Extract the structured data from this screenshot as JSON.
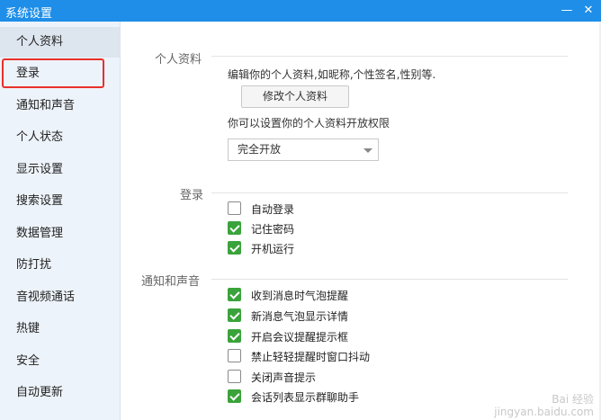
{
  "window": {
    "title": "系统设置",
    "minimize_icon": "minimize-icon",
    "close_icon": "close-icon"
  },
  "sidebar": {
    "items": [
      {
        "label": "个人资料",
        "active": true
      },
      {
        "label": "登录",
        "highlighted": true
      },
      {
        "label": "通知和声音"
      },
      {
        "label": "个人状态"
      },
      {
        "label": "显示设置"
      },
      {
        "label": "搜索设置"
      },
      {
        "label": "数据管理"
      },
      {
        "label": "防打扰"
      },
      {
        "label": "音视频通话"
      },
      {
        "label": "热键"
      },
      {
        "label": "安全"
      },
      {
        "label": "自动更新"
      }
    ],
    "highlight_color": "#e8302b"
  },
  "profile": {
    "section_title": "个人资料",
    "description": "编辑你的个人资料,如昵称,个性签名,性别等.",
    "edit_button": "修改个人资料",
    "permission_text": "你可以设置你的个人资料开放权限",
    "permission_select_value": "完全开放"
  },
  "login": {
    "section_title": "登录",
    "options": [
      {
        "label": "自动登录",
        "checked": false
      },
      {
        "label": "记住密码",
        "checked": true
      },
      {
        "label": "开机运行",
        "checked": true
      }
    ]
  },
  "notify": {
    "section_title": "通知和声音",
    "options": [
      {
        "label": "收到消息时气泡提醒",
        "checked": true
      },
      {
        "label": "新消息气泡显示详情",
        "checked": true
      },
      {
        "label": "开启会议提醒提示框",
        "checked": true
      },
      {
        "label": "禁止轻轻提醒时窗口抖动",
        "checked": false
      },
      {
        "label": "关闭声音提示",
        "checked": false
      },
      {
        "label": "会话列表显示群聊助手",
        "checked": true
      }
    ]
  },
  "watermark": {
    "line1": "Bai 经验",
    "line2": "jingyan.baidu.com"
  },
  "colors": {
    "titlebar": "#1e8ee8",
    "check_green": "#3aa33b",
    "sidebar_bg": "#edf3fa"
  }
}
